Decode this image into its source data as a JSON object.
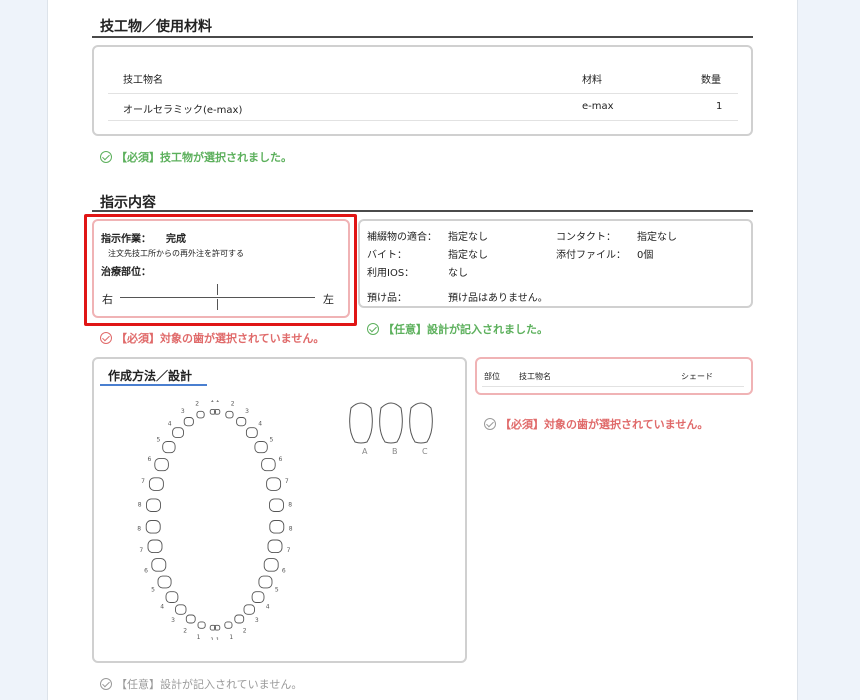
{
  "section1": {
    "title": "技工物／使用材料",
    "table": {
      "headers": [
        "技工物名",
        "材料",
        "数量"
      ],
      "rows": [
        [
          "オールセラミック(e-max)",
          "e-max",
          "1"
        ]
      ]
    },
    "status": "【必須】技工物が選択されました。"
  },
  "section2": {
    "title": "指示内容",
    "work_label": "指示作業：",
    "work_value": "完成",
    "note": "注文先技工所からの再外注を許可する",
    "site_label": "治療部位：",
    "right": "右",
    "left": "左",
    "status": "【必須】対象の歯が選択されていません。",
    "info": {
      "fit_label": "補綴物の適合：",
      "fit_value": "指定なし",
      "contact_label": "コンタクト：",
      "contact_value": "指定なし",
      "bite_label": "バイト：",
      "bite_value": "指定なし",
      "attach_label": "添付ファイル：",
      "attach_value": "0個",
      "ios_label": "利用IOS：",
      "ios_value": "なし",
      "deposit_label": "預け品：",
      "deposit_value": "預け品はありません。"
    },
    "info_status": "【任意】設計が記入されました。"
  },
  "section3": {
    "tab_title": "作成方法／設計",
    "shade_labels": [
      "A",
      "B",
      "C"
    ],
    "table_headers": [
      "部位",
      "技工物名",
      "シェード"
    ],
    "status_err": "【必須】対象の歯が選択されていません。",
    "status_gray": "【任意】設計が記入されていません。",
    "tooth_numbers_upper": [
      "1",
      "1",
      "2",
      "2",
      "3",
      "3",
      "4",
      "4",
      "5",
      "5",
      "6",
      "6",
      "7",
      "7",
      "8",
      "8"
    ],
    "tooth_numbers_lower": [
      "1",
      "1",
      "1",
      "1",
      "2",
      "2",
      "3",
      "3",
      "4",
      "4",
      "5",
      "5",
      "6",
      "6",
      "7",
      "7",
      "8",
      "8"
    ]
  },
  "colors": {
    "ok": "#5cb05c",
    "err": "#e06a6a",
    "highlight": "#e01515"
  }
}
